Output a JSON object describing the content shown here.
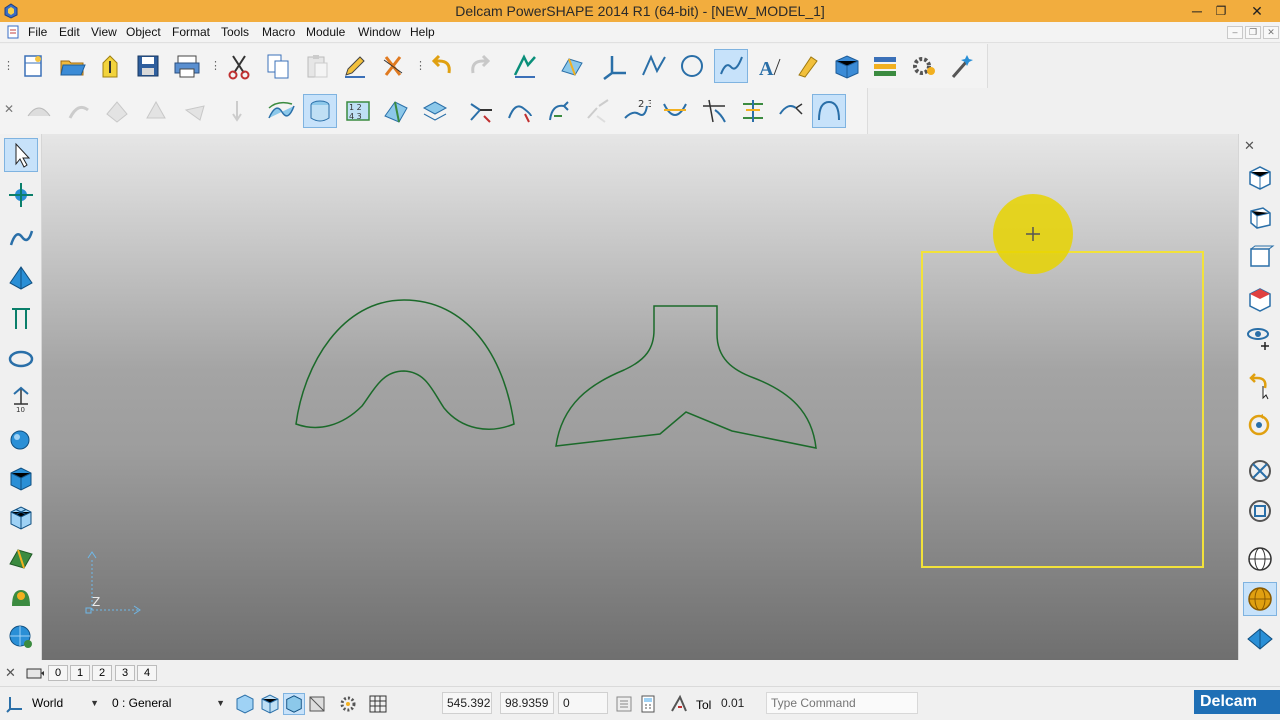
{
  "window": {
    "title": "Delcam PowerSHAPE 2014 R1 (64-bit) - [NEW_MODEL_1]",
    "minimize": "─",
    "restore": "❐",
    "close": "✕"
  },
  "menu": {
    "items": [
      "File",
      "Edit",
      "View",
      "Object",
      "Format",
      "Tools",
      "Macro",
      "Module",
      "Window",
      "Help"
    ],
    "mdi_minimize": "–",
    "mdi_restore": "❐",
    "mdi_close": "✕"
  },
  "toolbar1": {
    "icons": [
      "new-icon",
      "open-icon",
      "open-recent-icon",
      "save-icon",
      "print-icon",
      "cut-icon",
      "copy-icon",
      "paste-icon",
      "edit-pencil-icon",
      "delete-icon",
      "undo-icon",
      "redo-icon",
      "draw-icon",
      "sketch-icon",
      "axes-icon",
      "polyline-icon",
      "circle-icon",
      "curve-icon",
      "text-icon",
      "marker-icon",
      "box-icon",
      "layers-icon",
      "gear-icon",
      "wand-icon"
    ]
  },
  "toolbar2": {
    "icons": [
      "surface-icon",
      "surface2-icon",
      "surface3-icon",
      "surface4-icon",
      "surface5-icon",
      "pointer-icon",
      "wireframe-icon",
      "shaded-icon",
      "composite-icon",
      "surface-edit-icon",
      "layers-view-icon",
      "trim-icon",
      "curve-edit-icon",
      "curve-join-icon",
      "curve-break-icon",
      "curve-offset-icon",
      "curve-intersect-icon",
      "curve-fillet-icon",
      "curve-project-icon",
      "curve-extend-icon",
      "arc-icon"
    ]
  },
  "left_toolbar": {
    "icons": [
      "select-arrow-icon",
      "move-icon",
      "curve-tool-icon",
      "solid-tool-icon",
      "dimension-tool-icon",
      "ellipse-tool-icon",
      "workplane-tool-icon",
      "sphere-tool-icon",
      "solid-box-icon",
      "mesh-tool-icon",
      "model-tool-icon",
      "feature-tool-icon",
      "globe-tool-icon"
    ]
  },
  "right_toolbar": {
    "close": "✕",
    "icons": [
      "view-iso1-icon",
      "view-iso2-icon",
      "view-front-icon",
      "view-top-icon",
      "view-orbit-icon",
      "view-undo-icon",
      "view-redo-icon",
      "zoom-all-icon",
      "zoom-box-icon",
      "globe-view-icon",
      "shading-icon",
      "flat-view-icon"
    ]
  },
  "viewport": {
    "axis_label": "Z",
    "curve_color": "#1b6a2a",
    "frame_color": "#f2e23a",
    "cursor_color": "#e8d400"
  },
  "view_tabs": {
    "close": "✕",
    "tabs": [
      "0",
      "1",
      "2",
      "3",
      "4"
    ]
  },
  "status": {
    "workplane": "World",
    "level": "0 : General",
    "coord_x": "545.392",
    "coord_y": "98.9359",
    "coord_z": "0",
    "tol_label": "Tol",
    "tol_value": "0.01",
    "command_placeholder": "Type Command",
    "brand": "Delcam"
  }
}
